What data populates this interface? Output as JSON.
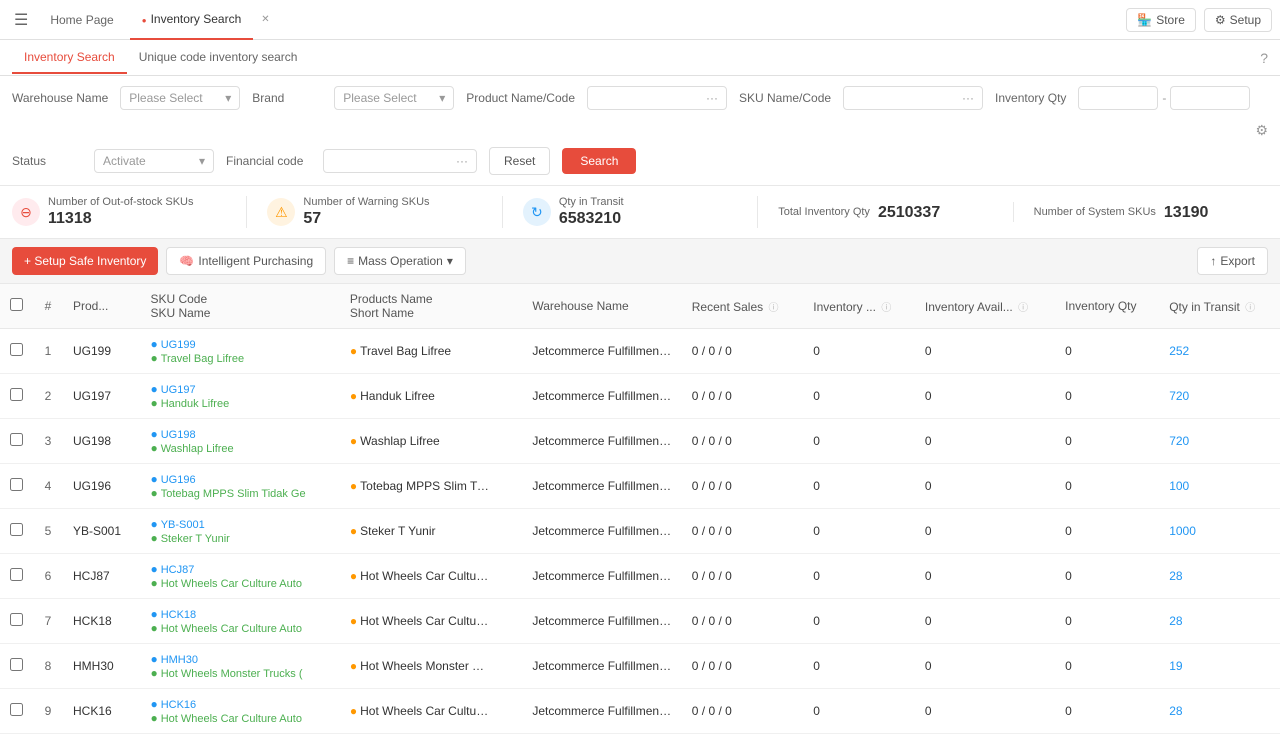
{
  "topNav": {
    "hamburgerLabel": "☰",
    "homePageLabel": "Home Page",
    "activeTabLabel": "Inventory Search",
    "storeLabel": "Store",
    "setupLabel": "Setup"
  },
  "subTabs": [
    {
      "id": "inventory-search",
      "label": "Inventory Search",
      "active": true
    },
    {
      "id": "unique-code-inventory",
      "label": "Unique code inventory search",
      "active": false
    }
  ],
  "filters": {
    "warehouseName": {
      "label": "Warehouse Name",
      "placeholder": "Please Select"
    },
    "brand": {
      "label": "Brand",
      "placeholder": "Please Select"
    },
    "productNameCode": {
      "label": "Product Name/Code",
      "placeholder": ""
    },
    "skuNameCode": {
      "label": "SKU Name/Code",
      "placeholder": ""
    },
    "inventoryQty": {
      "label": "Inventory Qty"
    },
    "status": {
      "label": "Status",
      "placeholder": "Activate"
    },
    "financialCode": {
      "label": "Financial code",
      "placeholder": ""
    },
    "resetLabel": "Reset",
    "searchLabel": "Search"
  },
  "stats": [
    {
      "id": "out-of-stock",
      "icon": "⊖",
      "iconClass": "red",
      "label": "Number of Out-of-stock SKUs",
      "value": "11318"
    },
    {
      "id": "warning-skus",
      "icon": "⚠",
      "iconClass": "orange",
      "label": "Number of Warning SKUs",
      "value": "57"
    },
    {
      "id": "qty-transit",
      "icon": "↻",
      "iconClass": "blue",
      "label": "Qty in Transit",
      "value": "6583210"
    },
    {
      "id": "total-inventory",
      "icon": "≡",
      "iconClass": "teal",
      "label": "Total Inventory Qty",
      "value": "2510337"
    },
    {
      "id": "system-skus",
      "label": "Number of System SKUs",
      "value": "13190"
    }
  ],
  "toolbar": {
    "setupSafeInventory": "+ Setup Safe Inventory",
    "intelligentPurchasing": "Intelligent Purchasing",
    "massOperation": "Mass Operation",
    "export": "Export"
  },
  "table": {
    "columns": [
      {
        "id": "num",
        "label": "#"
      },
      {
        "id": "prod",
        "label": "Prod..."
      },
      {
        "id": "sku",
        "label": "SKU Code\nSKU Name"
      },
      {
        "id": "products-name",
        "label": "Products Name\nShort Name"
      },
      {
        "id": "warehouse",
        "label": "Warehouse Name"
      },
      {
        "id": "recent-sales",
        "label": "Recent Sales"
      },
      {
        "id": "inventory",
        "label": "Inventory ..."
      },
      {
        "id": "inventory-avail",
        "label": "Inventory Avail..."
      },
      {
        "id": "inventory-qty",
        "label": "Inventory Qty"
      },
      {
        "id": "qty-transit",
        "label": "Qty in Transit"
      }
    ],
    "rows": [
      {
        "num": 1,
        "prod": "UG199",
        "skuCode": "UG199",
        "skuName": "Travel Bag Lifree",
        "productName": "Travel Bag Lifree",
        "shortName": "",
        "warehouse": "Jetcommerce Fulfillment Cente",
        "recentSales": "0 / 0 / 0",
        "inventory": "0",
        "inventoryAvail": "0",
        "inventoryQty": "0",
        "qtyTransit": "252"
      },
      {
        "num": 2,
        "prod": "UG197",
        "skuCode": "UG197",
        "skuName": "Handuk Lifree",
        "productName": "Handuk Lifree",
        "shortName": "",
        "warehouse": "Jetcommerce Fulfillment Cente",
        "recentSales": "0 / 0 / 0",
        "inventory": "0",
        "inventoryAvail": "0",
        "inventoryQty": "0",
        "qtyTransit": "720"
      },
      {
        "num": 3,
        "prod": "UG198",
        "skuCode": "UG198",
        "skuName": "Washlap Lifree",
        "productName": "Washlap Lifree",
        "shortName": "",
        "warehouse": "Jetcommerce Fulfillment Cente",
        "recentSales": "0 / 0 / 0",
        "inventory": "0",
        "inventoryAvail": "0",
        "inventoryQty": "0",
        "qtyTransit": "720"
      },
      {
        "num": 4,
        "prod": "UG196",
        "skuCode": "UG196",
        "skuName": "Totebag MPPS Slim Tidak Ge",
        "productName": "Totebag MPPS Slim Tidak Ge",
        "shortName": "",
        "warehouse": "Jetcommerce Fulfillment Cente",
        "recentSales": "0 / 0 / 0",
        "inventory": "0",
        "inventoryAvail": "0",
        "inventoryQty": "0",
        "qtyTransit": "100"
      },
      {
        "num": 5,
        "prod": "YB-S001",
        "skuCode": "YB-S001",
        "skuName": "Steker T Yunir",
        "productName": "Steker T Yunir",
        "shortName": "",
        "warehouse": "Jetcommerce Fulfillment Cente",
        "recentSales": "0 / 0 / 0",
        "inventory": "0",
        "inventoryAvail": "0",
        "inventoryQty": "0",
        "qtyTransit": "1000"
      },
      {
        "num": 6,
        "prod": "HCJ87",
        "skuCode": "HCJ87",
        "skuName": "Hot Wheels Car Culture Auto",
        "productName": "Hot Wheels Car Culture Auto",
        "shortName": "",
        "warehouse": "Jetcommerce Fulfillment Cente",
        "recentSales": "0 / 0 / 0",
        "inventory": "0",
        "inventoryAvail": "0",
        "inventoryQty": "0",
        "qtyTransit": "28"
      },
      {
        "num": 7,
        "prod": "HCK18",
        "skuCode": "HCK18",
        "skuName": "Hot Wheels Car Culture Auto",
        "productName": "Hot Wheels Car Culture Auto",
        "shortName": "",
        "warehouse": "Jetcommerce Fulfillment Cente",
        "recentSales": "0 / 0 / 0",
        "inventory": "0",
        "inventoryAvail": "0",
        "inventoryQty": "0",
        "qtyTransit": "28"
      },
      {
        "num": 8,
        "prod": "HMH30",
        "skuCode": "HMH30",
        "skuName": "Hot Wheels Monster Trucks (",
        "productName": "Hot Wheels Monster Trucks (",
        "shortName": "",
        "warehouse": "Jetcommerce Fulfillment Cente",
        "recentSales": "0 / 0 / 0",
        "inventory": "0",
        "inventoryAvail": "0",
        "inventoryQty": "0",
        "qtyTransit": "19"
      },
      {
        "num": 9,
        "prod": "HCK16",
        "skuCode": "HCK16",
        "skuName": "Hot Wheels Car Culture Auto",
        "productName": "Hot Wheels Car Culture Auto",
        "shortName": "",
        "warehouse": "Jetcommerce Fulfillment Cente",
        "recentSales": "0 / 0 / 0",
        "inventory": "0",
        "inventoryAvail": "0",
        "inventoryQty": "0",
        "qtyTransit": "28"
      }
    ]
  }
}
